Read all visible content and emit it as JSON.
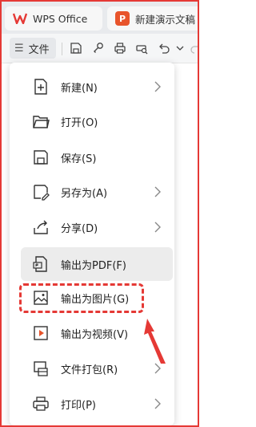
{
  "tabs": {
    "wps": {
      "label": "WPS Office"
    },
    "doc": {
      "label": "新建演示文稿",
      "logo_text": "P"
    }
  },
  "toolbar": {
    "file_label": "文件",
    "icons": [
      "save-icon",
      "share-icon",
      "print-icon",
      "print-preview-icon",
      "undo-icon",
      "dropdown-icon"
    ]
  },
  "menu": {
    "items": [
      {
        "label": "新建(N)",
        "icon": "new-file-icon",
        "has_submenu": true
      },
      {
        "label": "打开(O)",
        "icon": "folder-open-icon",
        "has_submenu": false
      },
      {
        "label": "保存(S)",
        "icon": "save-icon",
        "has_submenu": false
      },
      {
        "label": "另存为(A)",
        "icon": "save-as-icon",
        "has_submenu": true
      },
      {
        "label": "分享(D)",
        "icon": "share-icon",
        "has_submenu": true
      },
      {
        "label": "输出为PDF(F)",
        "icon": "export-pdf-icon",
        "has_submenu": false
      },
      {
        "label": "输出为图片(G)",
        "icon": "export-image-icon",
        "has_submenu": false
      },
      {
        "label": "输出为视频(V)",
        "icon": "export-video-icon",
        "has_submenu": false
      },
      {
        "label": "文件打包(R)",
        "icon": "package-icon",
        "has_submenu": true
      },
      {
        "label": "打印(P)",
        "icon": "print-icon",
        "has_submenu": true
      }
    ]
  },
  "colors": {
    "accent_red": "#e53935",
    "hover_bg": "#ececec",
    "video_icon": "#e8542b"
  }
}
